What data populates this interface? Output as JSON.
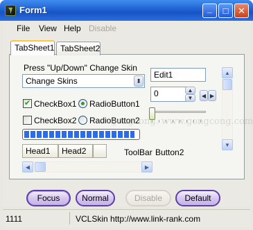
{
  "window": {
    "title": "Form1"
  },
  "title_buttons": {
    "minimize": "_",
    "maximize": "□",
    "close": "✕"
  },
  "menu": [
    {
      "label": "File"
    },
    {
      "label": "View"
    },
    {
      "label": "Help"
    },
    {
      "label": "Disable",
      "disabled": true
    }
  ],
  "tabs": [
    {
      "label": "TabSheet1",
      "active": true
    },
    {
      "label": "TabSheet2",
      "active": false
    }
  ],
  "panel": {
    "skin_label": "Press \"Up/Down\" Change Skin",
    "skin_combo": {
      "value": "Change Skins"
    },
    "edit1": {
      "value": "Edit1"
    },
    "spin": {
      "value": "0"
    },
    "checkbox1": {
      "label": "CheckBox1",
      "checked": true
    },
    "checkbox2": {
      "label": "CheckBox2",
      "checked": false
    },
    "radio1": {
      "label": "RadioButton1",
      "selected": true
    },
    "radio2": {
      "label": "RadioButton2",
      "selected": false
    },
    "progress": {
      "fraction": 0.97
    },
    "slider": {
      "fraction": 0.0
    },
    "headers": [
      "Head1",
      "Head2",
      ""
    ],
    "toolbar_label": "ToolBar",
    "button2_label": "Button2",
    "watermark": "gongcong.  www.gongcong.com"
  },
  "buttons": {
    "focus": "Focus",
    "normal": "Normal",
    "disable": "Disable",
    "default": "Default"
  },
  "status": {
    "panel1": "1111",
    "panel2": "VCLSkin http://www.link-rank.com"
  },
  "colors": {
    "title_blue": "#1f62d2",
    "button_border": "#5c3ea6",
    "check_green": "#21a121"
  }
}
